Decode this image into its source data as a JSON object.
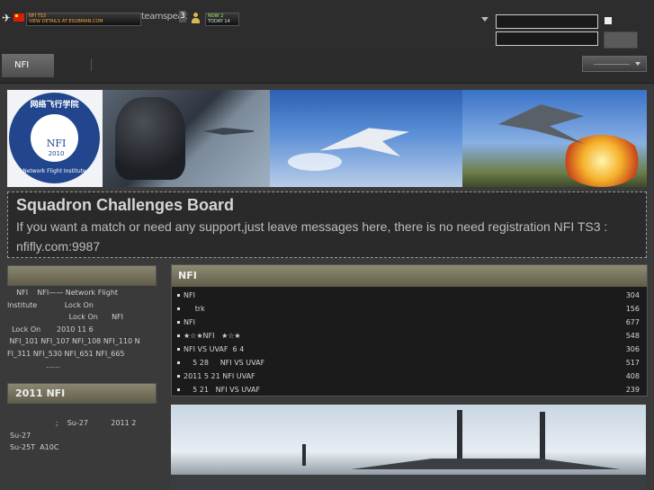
{
  "topbar": {
    "ticker_line1": "NFI  TS3",
    "ticker_line2": "VIEW DETAILS AT ESUBMAN.COM",
    "teamspeak_label": "teamspeak",
    "teamspeak_version": "3",
    "online_line1": "NOW 2",
    "online_line2": "TODAY 14",
    "icons": [
      "plane-icon",
      "flag-icon",
      "users-icon",
      "dropdown-arrow-icon"
    ]
  },
  "login": {
    "username_value": "",
    "password_value": "",
    "button_label": ""
  },
  "nav": {
    "tabs": [
      {
        "label": "NFI"
      }
    ],
    "select_value": ""
  },
  "banner": {
    "emblem_arc_top": "网络飞行学院",
    "emblem_center": "NFI",
    "emblem_year": "2010",
    "emblem_arc_bottom": "Network Flight Institute"
  },
  "board": {
    "title": "Squadron Challenges Board",
    "description": "If you want a match or need any support,just leave messages here, there is no need registration NFI TS3 : nfifly.com:9987"
  },
  "left": {
    "section1_title": "",
    "section1_lines": [
      "    NFI    NFI—— Network Flight",
      "Institute            Lock On",
      "                           Lock On      NFI",
      "  Lock On       2010 11 6",
      " NFI_101 NFI_107 NFI_108 NFI_110 N",
      "FI_311 NFI_530 NFI_651 NFI_665",
      "                 ......"
    ],
    "section2_title": "2011  NFI",
    "section2_lines": [
      "                    ;    Su-27          2011 2",
      "Su-27",
      "Su-25T  A10C"
    ]
  },
  "forum": {
    "header": "NFI",
    "rows": [
      {
        "title": "NFI",
        "count": "304"
      },
      {
        "title": "     trk",
        "count": "156"
      },
      {
        "title": "NFI",
        "count": "677"
      },
      {
        "title": "★☆★NFI   ★☆★",
        "count": "548"
      },
      {
        "title": "NFI VS UVAF  6 4",
        "count": "306"
      },
      {
        "title": "    5 28     NFI VS UVAF",
        "count": "517"
      },
      {
        "title": "2011 5 21 NFI UVAF",
        "count": "408"
      },
      {
        "title": "    5 21   NFI VS UVAF",
        "count": "239"
      }
    ]
  }
}
